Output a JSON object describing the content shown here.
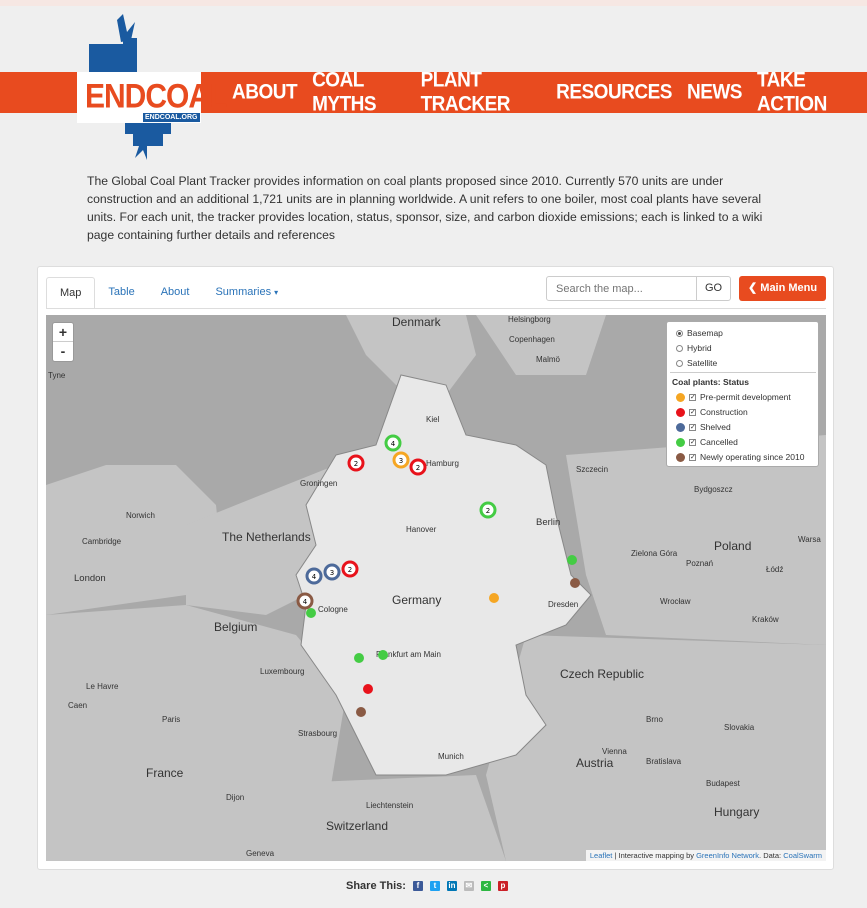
{
  "header": {
    "logo_text": "ENDCOAL",
    "logo_sub": "ENDCOAL.ORG",
    "nav": [
      "ABOUT",
      "COAL MYTHS",
      "PLANT TRACKER",
      "RESOURCES",
      "NEWS",
      "TAKE ACTION"
    ]
  },
  "intro": "The Global Coal Plant Tracker provides information on coal plants proposed since 2010. Currently 570 units are under construction and an additional 1,721 units are in planning worldwide. A unit refers to one boiler, most coal plants have several units. For each unit, the tracker provides location, status, sponsor, size, and carbon dioxide emissions; each is linked to a wiki page containing further details and references",
  "tabs": [
    "Map",
    "Table",
    "About",
    "Summaries"
  ],
  "search": {
    "placeholder": "Search the map...",
    "go": "GO"
  },
  "main_menu": "Main Menu",
  "zoom": {
    "in": "+",
    "out": "-"
  },
  "legend": {
    "basemaps": [
      "Basemap",
      "Hybrid",
      "Satellite"
    ],
    "title": "Coal plants: Status",
    "statuses": [
      {
        "label": "Pre-permit development",
        "color": "#f5a623"
      },
      {
        "label": "Construction",
        "color": "#e8121b"
      },
      {
        "label": "Shelved",
        "color": "#4d6a9a"
      },
      {
        "label": "Cancelled",
        "color": "#44cc44"
      },
      {
        "label": "Newly operating since 2010",
        "color": "#8a5a44"
      }
    ]
  },
  "map_labels": {
    "countries": [
      "Denmark",
      "The Netherlands",
      "Germany",
      "Belgium",
      "France",
      "Poland",
      "Czech Republic",
      "Austria",
      "Hungary",
      "Switzerland",
      "Luxembourg",
      "Slovakia"
    ],
    "cities": [
      "Helsingborg",
      "Copenhagen",
      "Malmö",
      "Tyne",
      "Kiel",
      "Hamburg",
      "Szczecin",
      "Groningen",
      "Bydgoszcz",
      "Norwich",
      "Hanover",
      "Berlin",
      "Cambridge",
      "Zielona Góra",
      "Warsa",
      "London",
      "Poznań",
      "Łódź",
      "Cologne",
      "Dresden",
      "Wrocław",
      "Frankfurt am Main",
      "Le Havre",
      "Caen",
      "Paris",
      "Strasbourg",
      "Munich",
      "Vienna",
      "Bratislava",
      "Budapest",
      "Dijon",
      "Liechtenstein",
      "Geneva",
      "Kraków",
      "Brno"
    ]
  },
  "markers": [
    {
      "type": "cluster",
      "count": "4",
      "color": "#44cc44"
    },
    {
      "type": "cluster",
      "count": "2",
      "color": "#e8121b"
    },
    {
      "type": "cluster",
      "count": "3",
      "color": "#f5a623"
    },
    {
      "type": "cluster",
      "count": "2",
      "color": "#e8121b"
    },
    {
      "type": "cluster",
      "count": "2",
      "color": "#44cc44"
    },
    {
      "type": "cluster",
      "count": "4",
      "color": "#4d6a9a"
    },
    {
      "type": "cluster",
      "count": "3",
      "color": "#4d6a9a"
    },
    {
      "type": "cluster",
      "count": "2",
      "color": "#e8121b"
    },
    {
      "type": "cluster",
      "count": "4",
      "color": "#8a5a44"
    }
  ],
  "attribution": {
    "leaflet": "Leaflet",
    "text": "| Interactive mapping by",
    "gi": "GreenInfo Network",
    "data": ". Data:",
    "cs": "CoalSwarm"
  },
  "share": {
    "label": "Share This:"
  }
}
